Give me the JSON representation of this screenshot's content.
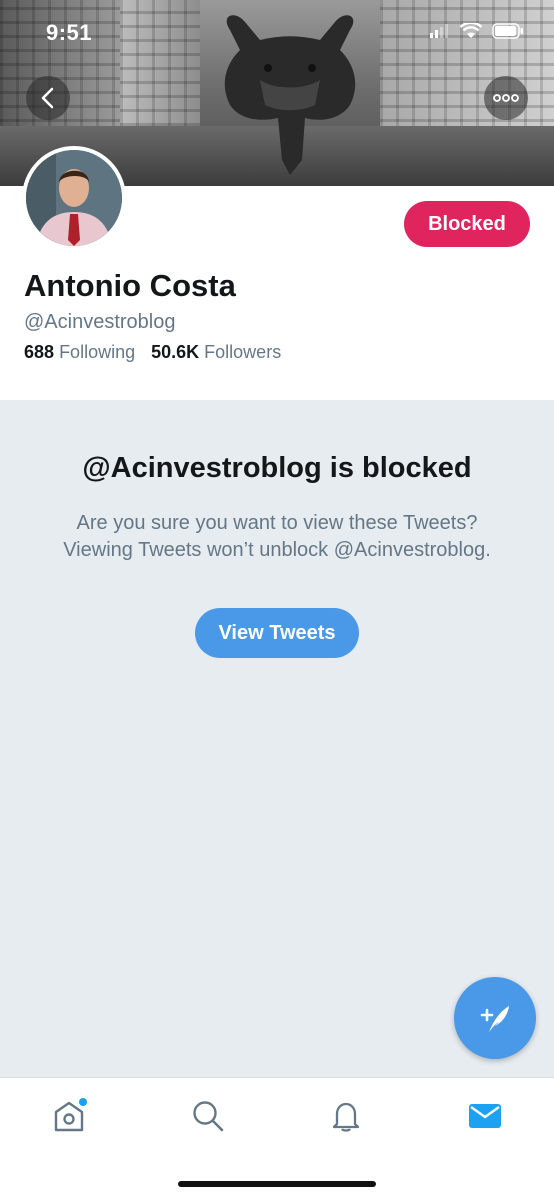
{
  "status_bar": {
    "time": "9:51"
  },
  "profile": {
    "name": "Antonio Costa",
    "handle": "@Acinvestroblog",
    "following_count": "688",
    "following_label": "Following",
    "followers_count": "50.6K",
    "followers_label": "Followers",
    "blocked_button": "Blocked"
  },
  "blocked_notice": {
    "title": "@Acinvestroblog is blocked",
    "message": "Are you sure you want to view these Tweets? Viewing Tweets won’t unblock @Acinvestroblog.",
    "view_button": "View Tweets"
  },
  "tabs": [
    {
      "icon": "home-icon",
      "has_notification_dot": true
    },
    {
      "icon": "search-icon"
    },
    {
      "icon": "bell-icon"
    },
    {
      "icon": "mail-icon",
      "active": true
    }
  ],
  "colors": {
    "accent": "#4a99e9",
    "blocked": "#e0245e",
    "text": "#14171a",
    "muted": "#657786",
    "bg": "#e6ecf0"
  }
}
